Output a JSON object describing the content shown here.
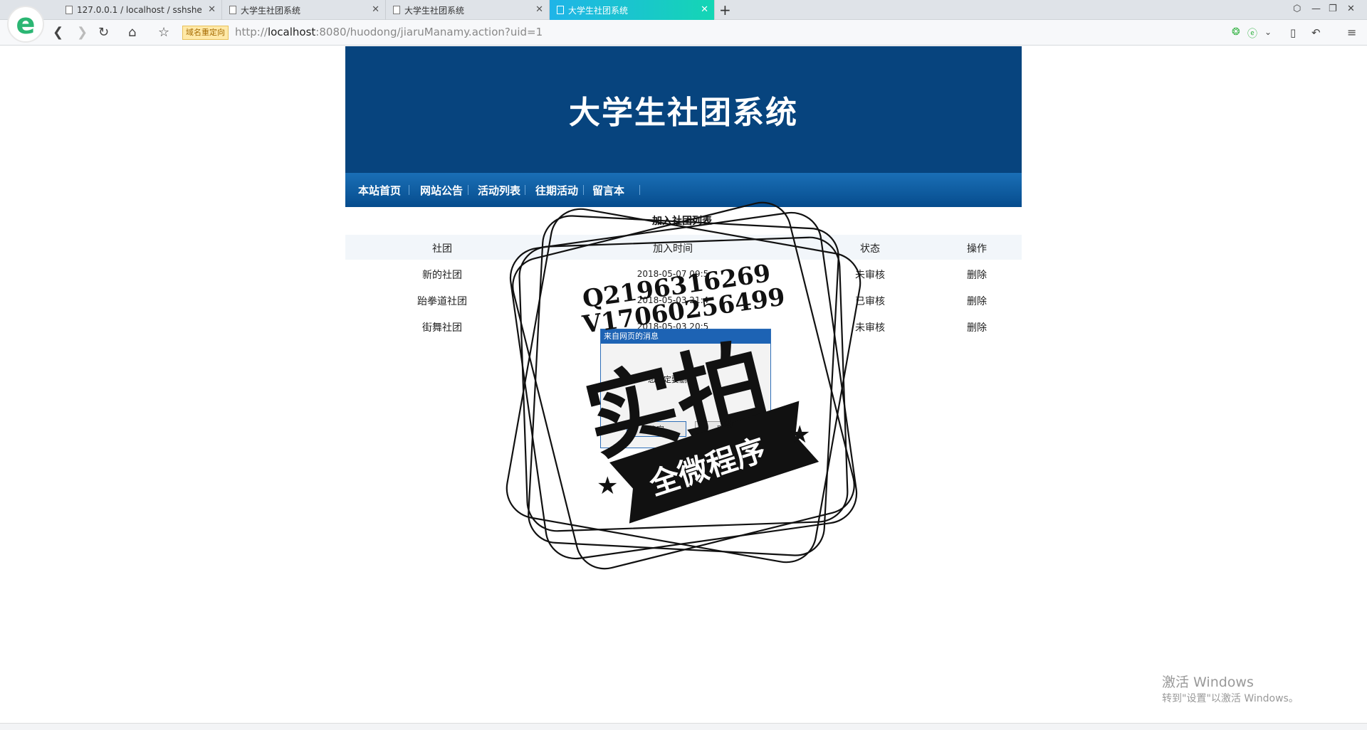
{
  "browser": {
    "tabs": [
      {
        "label": "127.0.0.1 / localhost / sshshe",
        "active": false
      },
      {
        "label": "大学生社团系统",
        "active": false
      },
      {
        "label": "大学生社团系统",
        "active": false
      },
      {
        "label": "大学生社团系统",
        "active": true
      }
    ],
    "logo_letter": "e",
    "redirect_badge": "域名重定向",
    "url_prefix": "http://",
    "url_host": "localhost",
    "url_rest": ":8080/huodong/jiaruManamy.action?uid=1",
    "accent_color": "#1fb4e8"
  },
  "site": {
    "title": "大学生社团系统",
    "menu": [
      "本站首页",
      "网站公告",
      "活动列表",
      "往期活动",
      "留言本"
    ],
    "brand_color": "#07447e"
  },
  "table": {
    "title": "加入社团列表",
    "headers": [
      "社团",
      "加入时间",
      "状态",
      "操作"
    ],
    "rows": [
      {
        "club": "新的社团",
        "time": "2018-05-07 09:5",
        "status": "未审核",
        "action": "删除"
      },
      {
        "club": "跆拳道社团",
        "time": "2018-05-03 21:4",
        "status": "已审核",
        "action": "删除"
      },
      {
        "club": "街舞社团",
        "time": "2018-05-03 20:5",
        "status": "未审核",
        "action": "删除"
      }
    ]
  },
  "dialog": {
    "title": "来自网页的消息",
    "message": "您确定要删除",
    "ok_label": "确定",
    "cancel_label": "取消"
  },
  "stamp": {
    "line1": "Q2196316269",
    "line2": "V17060256499",
    "big_text": "实拍",
    "ribbon_text": "全微程序"
  },
  "windows": {
    "activate_title": "激活 Windows",
    "activate_hint": "转到\"设置\"以激活 Windows。"
  }
}
